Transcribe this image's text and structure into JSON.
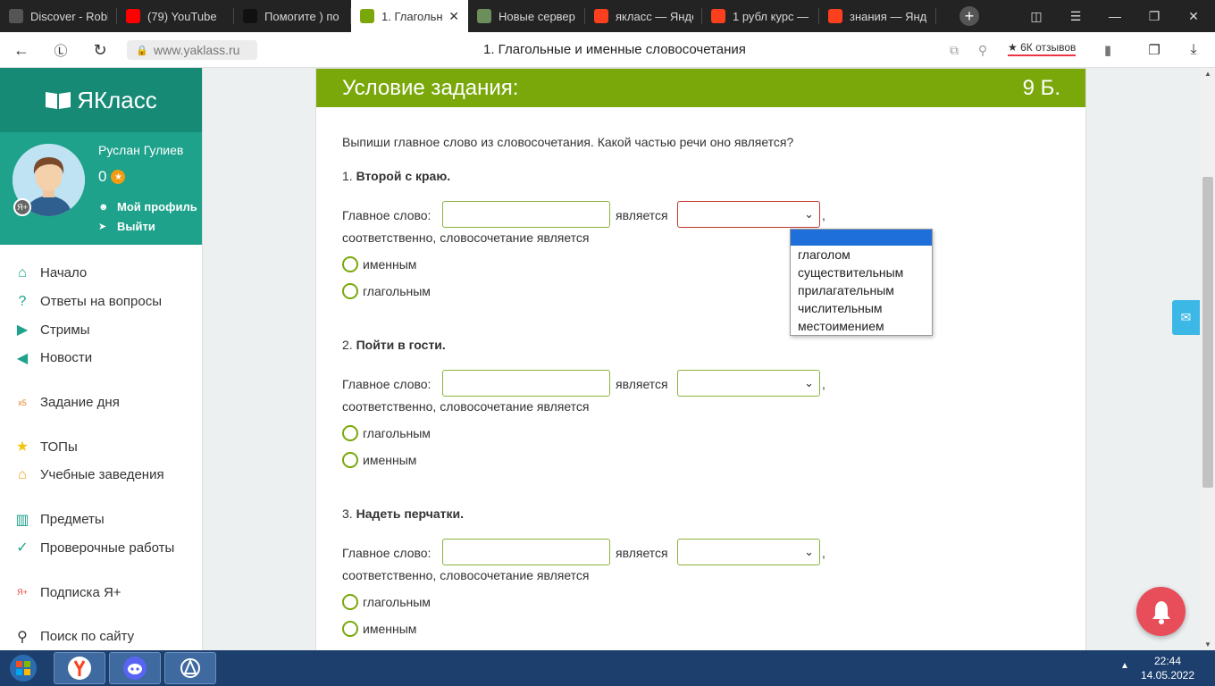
{
  "browser": {
    "tabs": [
      {
        "title": "Discover - Roblox",
        "icon": "roblox-icon",
        "icon_color": "#555555"
      },
      {
        "title": "(79) YouTube",
        "icon": "youtube-icon",
        "icon_color": "#ff0000"
      },
      {
        "title": "Помогите ) по",
        "icon": "znanija-icon",
        "icon_color": "#111111"
      },
      {
        "title": "1. Глагольн",
        "icon": "yaklass-icon",
        "icon_color": "#7aa80b",
        "active": true
      },
      {
        "title": "Новые сервер",
        "icon": "globe-icon",
        "icon_color": "#6b8e5a"
      },
      {
        "title": "якласс — Янде",
        "icon": "yandex-icon",
        "icon_color": "#fc3f1d"
      },
      {
        "title": "1 рубл курс —",
        "icon": "yandex-icon",
        "icon_color": "#fc3f1d"
      },
      {
        "title": "знания — Янде",
        "icon": "yandex-icon",
        "icon_color": "#fc3f1d"
      }
    ],
    "url": "www.yaklass.ru",
    "page_title": "1. Глагольные и именные словосочетания",
    "reviews": "6К отзывов"
  },
  "sidebar": {
    "logo": "ЯКласс",
    "user_name": "Руслан Гулиев",
    "score": "0",
    "profile_link": "Мой профиль",
    "logout_link": "Выйти",
    "menu": [
      {
        "label": "Начало",
        "icon": "home-icon"
      },
      {
        "label": "Ответы на вопросы",
        "icon": "question-icon"
      },
      {
        "label": "Стримы",
        "icon": "play-icon"
      },
      {
        "label": "Новости",
        "icon": "megaphone-icon"
      },
      {
        "label": "Задание дня",
        "icon": "x5-icon"
      },
      {
        "label": "ТОПы",
        "icon": "star-icon"
      },
      {
        "label": "Учебные заведения",
        "icon": "school-icon"
      },
      {
        "label": "Предметы",
        "icon": "books-icon"
      },
      {
        "label": "Проверочные работы",
        "icon": "check-icon"
      },
      {
        "label": "Подписка Я+",
        "icon": "yaplus-icon"
      },
      {
        "label": "Поиск по сайту",
        "icon": "search-icon"
      }
    ]
  },
  "task": {
    "header": "Условие задания:",
    "points": "9 Б.",
    "instruction": "Выпиши главное слово из словосочетания. Какой частью речи оно является?",
    "main_word_label": "Главное слово:",
    "is_label": "является",
    "comma": ",",
    "accordingly": "соответственно, словосочетание является",
    "items": [
      {
        "num": "1.",
        "phrase": "Второй с краю.",
        "options": [
          "именным",
          "глагольным"
        ]
      },
      {
        "num": "2.",
        "phrase": "Пойти в гости.",
        "options": [
          "глагольным",
          "именным"
        ]
      },
      {
        "num": "3.",
        "phrase": "Надеть перчатки.",
        "options": [
          "глагольным",
          "именным"
        ]
      }
    ],
    "dropdown_options": [
      "",
      "глаголом",
      "существительным",
      "прилагательным",
      "числительным",
      "местоимением"
    ]
  },
  "taskbar": {
    "time": "22:44",
    "date": "14.05.2022"
  }
}
